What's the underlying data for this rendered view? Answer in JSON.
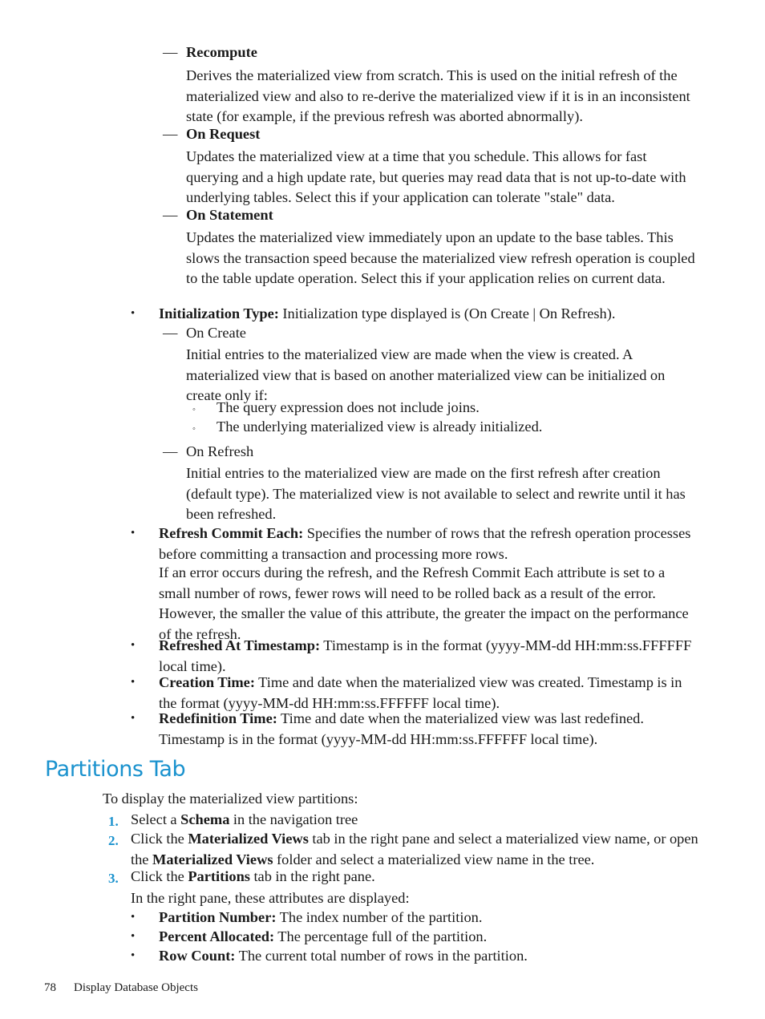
{
  "page": {
    "footer_page_number": "78",
    "footer_title": "Display Database Objects",
    "accent_color": "#1a92ce",
    "text_color": "#1a1a1a",
    "background_color": "#ffffff"
  },
  "markers": {
    "bullet": "•",
    "dash": "—",
    "circle": "◦",
    "num1": "1.",
    "num2": "2.",
    "num3": "3."
  },
  "content": {
    "recompute_term": "Recompute",
    "recompute_body": "Derives the materialized view from scratch. This is used on the initial refresh of the materialized view and also to re-derive the materialized view if it is in an inconsistent state (for example, if the previous refresh was aborted abnormally).",
    "on_request_term": "On Request",
    "on_request_body": "Updates the materialized view at a time that you schedule. This allows for fast querying and a high update rate, but queries may read data that is not up-to-date with underlying tables. Select this if your application can tolerate \"stale\" data.",
    "on_statement_term": "On Statement",
    "on_statement_body": "Updates the materialized view immediately upon an update to the base tables. This slows the transaction speed because the materialized view refresh operation is coupled to the table update operation. Select this if your application relies on current data.",
    "init_type_label": "Initialization Type:",
    "init_type_body": " Initialization type displayed is (On Create | On Refresh).",
    "on_create_term": "On Create",
    "on_create_body": "Initial entries to the materialized view are made when the view is created. A materialized view that is based on another materialized view can be initialized on create only if:",
    "on_create_sub1": "The query expression does not include joins.",
    "on_create_sub2": "The underlying materialized view is already initialized.",
    "on_refresh_term": "On Refresh",
    "on_refresh_body": "Initial entries to the materialized view are made on the first refresh after creation (default type). The materialized view is not available to select and rewrite until it has been refreshed.",
    "refresh_commit_label": "Refresh Commit Each:",
    "refresh_commit_body": " Specifies the number of rows that the refresh operation processes before committing a transaction and processing more rows.",
    "refresh_commit_body2": "If an error occurs during the refresh, and the Refresh Commit Each attribute is set to a small number of rows, fewer rows will need to be rolled back as a result of the error. However, the smaller the value of this attribute, the greater the impact on the performance of the refresh.",
    "refreshed_at_label": "Refreshed At Timestamp:",
    "refreshed_at_body": " Timestamp is in the format (yyyy-MM-dd HH:mm:ss.FFFFFF local time).",
    "creation_time_label": "Creation Time:",
    "creation_time_body": " Time and date when the materialized view was created. Timestamp is in the format (yyyy-MM-dd HH:mm:ss.FFFFFF local time).",
    "redefinition_time_label": "Redefinition Time:",
    "redefinition_time_body": " Time and date when the materialized view was last redefined. Timestamp is in the format (yyyy-MM-dd HH:mm:ss.FFFFFF local time).",
    "section_heading": "Partitions Tab",
    "intro": "To display the materialized view partitions:",
    "step1_pre": "Select a ",
    "step1_bold": "Schema",
    "step1_post": " in the navigation tree",
    "step2_pre": "Click the ",
    "step2_bold1": "Materialized Views",
    "step2_mid": " tab in the right pane and select a materialized view name, or open the ",
    "step2_bold2": "Materialized Views",
    "step2_post": " folder and select a materialized view name in the tree.",
    "step3_pre": "Click the ",
    "step3_bold": "Partitions",
    "step3_post": " tab in the right pane.",
    "attributes_intro": "In the right pane, these attributes are displayed:",
    "partition_number_label": "Partition Number:",
    "partition_number_body": " The index number of the partition.",
    "percent_allocated_label": "Percent Allocated:",
    "percent_allocated_body": " The percentage full of the partition.",
    "row_count_label": "Row Count:",
    "row_count_body": " The current total number of rows in the partition."
  }
}
